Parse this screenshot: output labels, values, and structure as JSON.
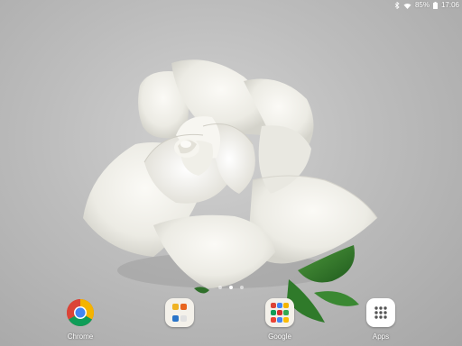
{
  "status_bar": {
    "battery_percent": "85%",
    "time": "17:06",
    "icons": [
      "bluetooth-icon",
      "wifi-icon",
      "battery-icon"
    ]
  },
  "wallpaper": {
    "subject": "white-rose-image"
  },
  "page_indicator": {
    "pages": 3,
    "active_index": 1
  },
  "dock": {
    "apps": [
      {
        "label": "Chrome",
        "icon": "chrome-icon"
      },
      {
        "label": "",
        "icon": "folder-icon"
      },
      {
        "label": "Google",
        "icon": "google-folder-icon"
      },
      {
        "label": "Apps",
        "icon": "apps-grid-icon"
      }
    ]
  },
  "colors": {
    "status_text": "#ffffff",
    "chrome_red": "#db4437",
    "chrome_yellow": "#f4b400",
    "chrome_green": "#0f9d58",
    "chrome_blue": "#4285f4"
  }
}
